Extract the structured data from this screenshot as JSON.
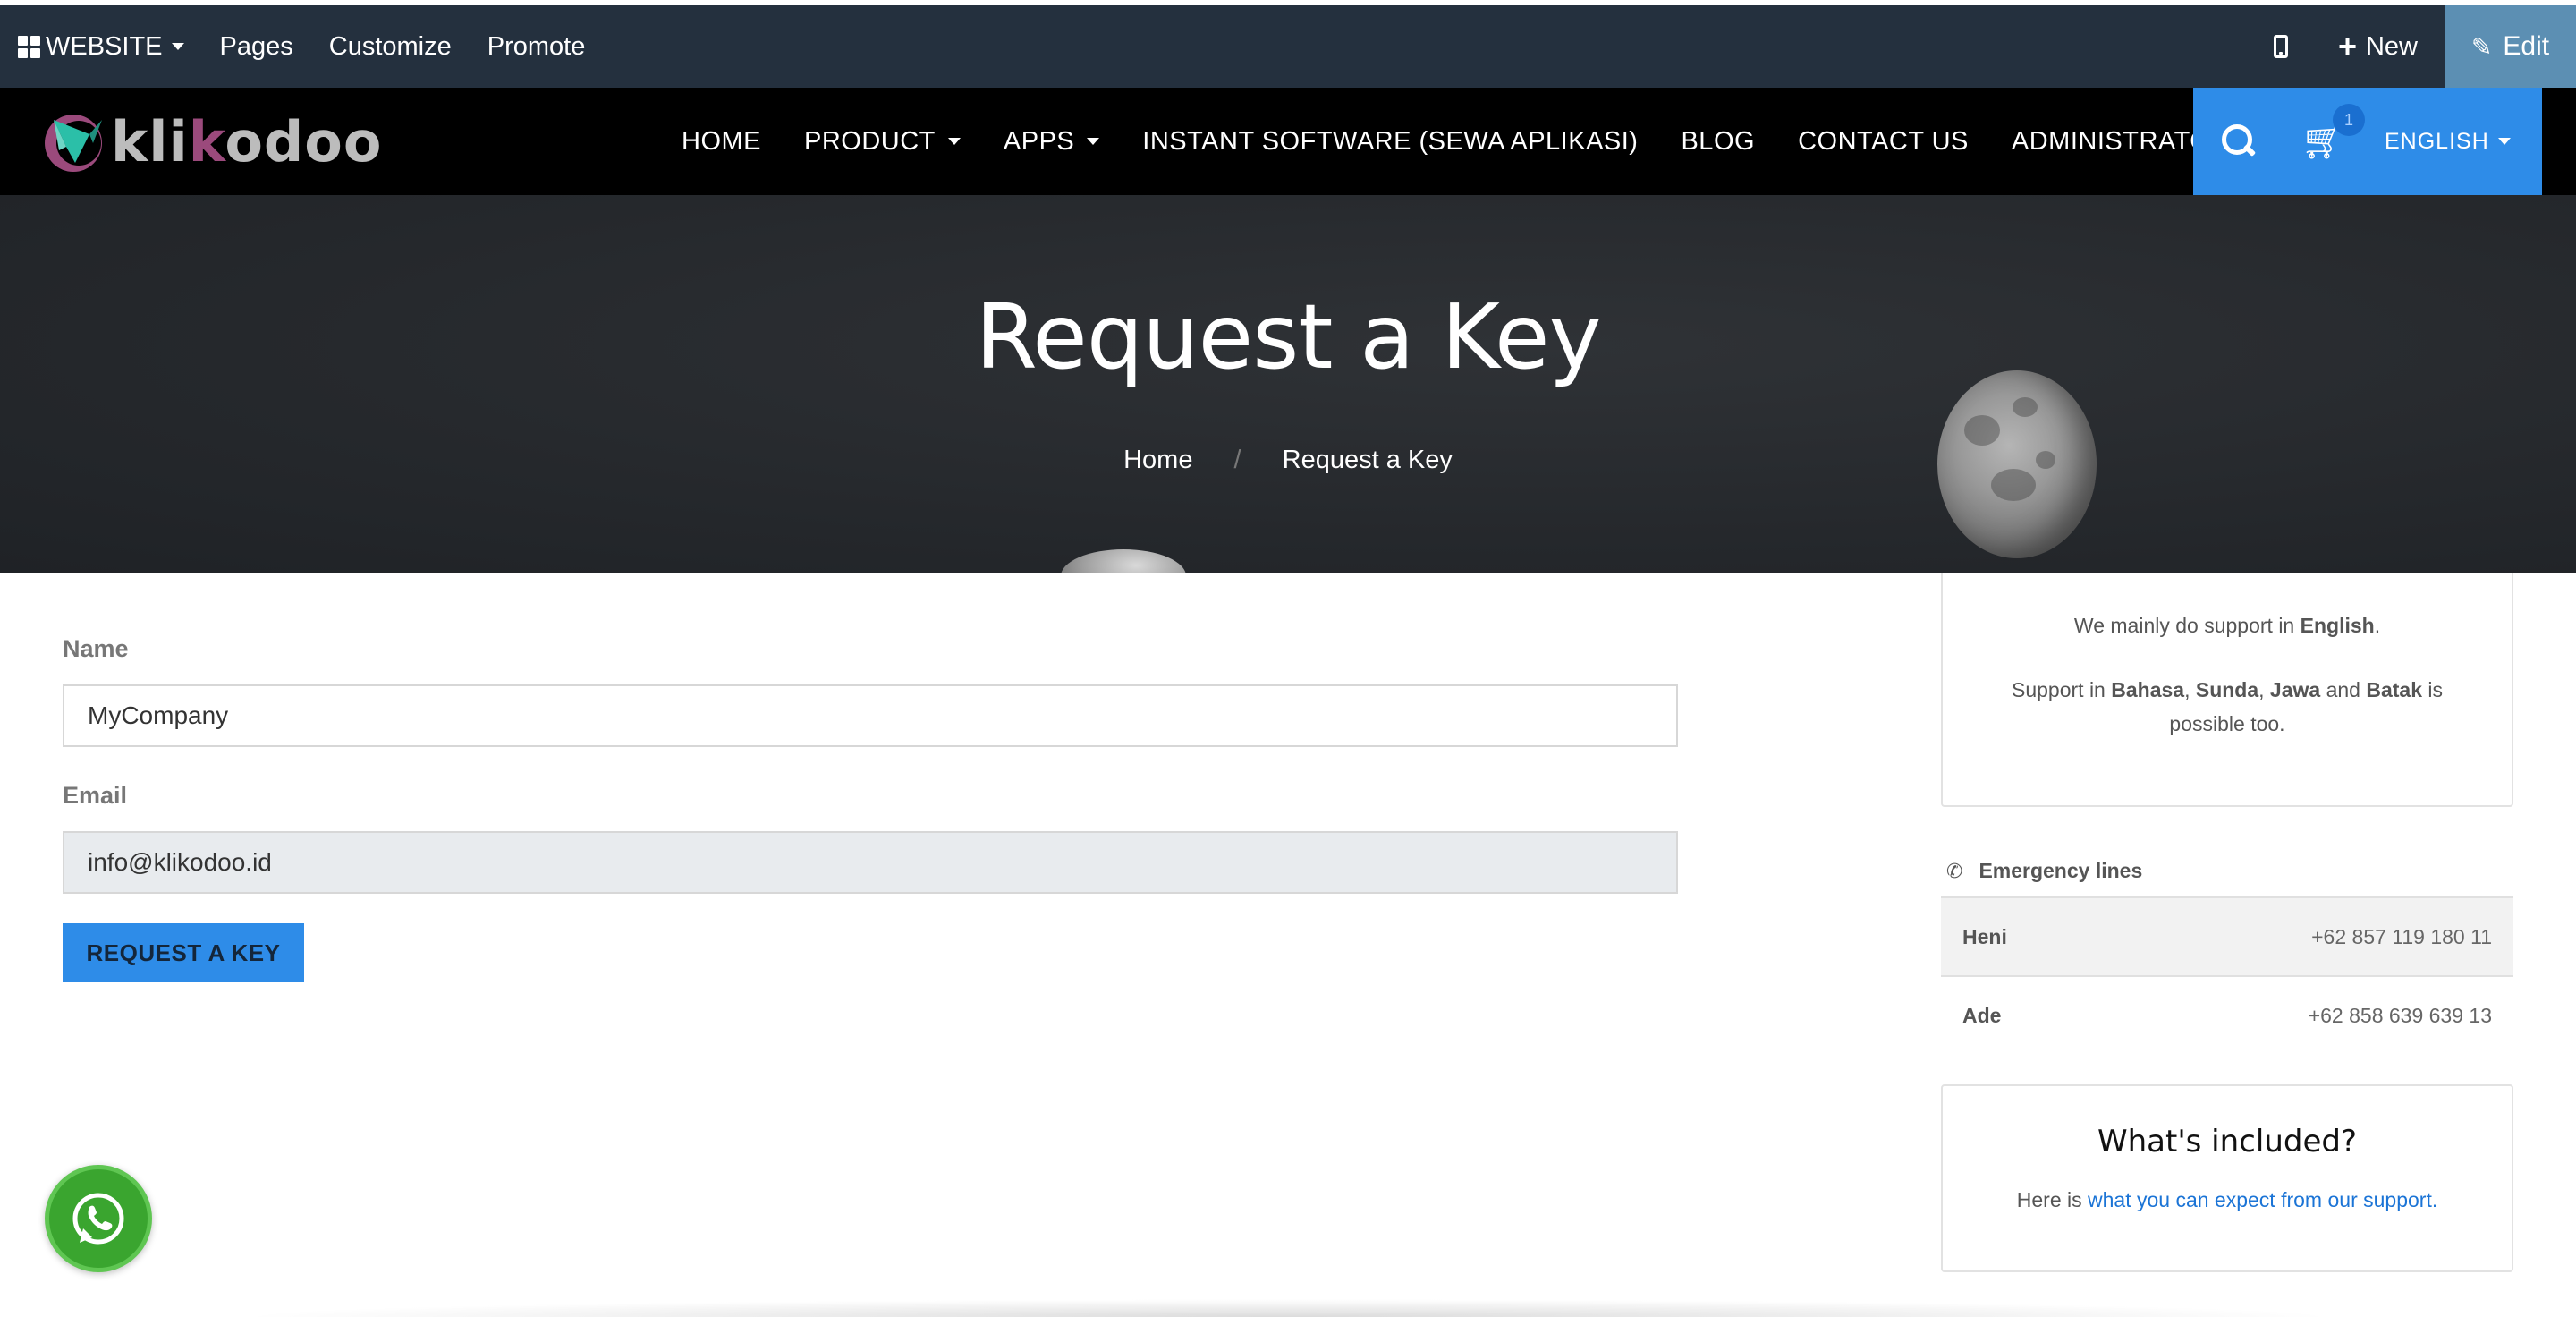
{
  "admin_bar": {
    "website_label": "WEBSITE",
    "pages_label": "Pages",
    "customize_label": "Customize",
    "promote_label": "Promote",
    "new_label": "New",
    "edit_label": "Edit"
  },
  "navbar": {
    "logo": {
      "part1": "kli",
      "part2": "k",
      "part3": "odoo"
    },
    "items": [
      {
        "label": "HOME",
        "dropdown": false
      },
      {
        "label": "PRODUCT",
        "dropdown": true
      },
      {
        "label": "APPS",
        "dropdown": true
      },
      {
        "label": "INSTANT SOFTWARE (SEWA APLIKASI)",
        "dropdown": false
      },
      {
        "label": "BLOG",
        "dropdown": false
      },
      {
        "label": "CONTACT US",
        "dropdown": false
      },
      {
        "label": "ADMINISTRATOR",
        "dropdown": true
      }
    ],
    "cart_count": "1",
    "language": "ENGLISH",
    "accent_color": "#2e8ce8"
  },
  "hero": {
    "title": "Request a Key",
    "breadcrumb": {
      "home": "Home",
      "separator": "/",
      "current": "Request a Key"
    }
  },
  "form": {
    "name_label": "Name",
    "name_value": "MyCompany",
    "email_label": "Email",
    "email_value": "info@klikodoo.id",
    "submit_label": "REQUEST A KEY"
  },
  "support_card": {
    "line1_prefix": "We mainly do support in ",
    "line1_lang": "English",
    "line1_suffix": ".",
    "line2_prefix": "Support in ",
    "lang1": "Bahasa",
    "comma1": ", ",
    "lang2": "Sunda",
    "comma2": ", ",
    "lang3": "Jawa",
    "and_text": " and ",
    "lang4": "Batak",
    "line2_suffix": " is possible too."
  },
  "emergency": {
    "title": "Emergency lines",
    "contacts": [
      {
        "name": "Heni",
        "phone": "+62 857 119 180 11"
      },
      {
        "name": "Ade",
        "phone": "+62 858 639 639 13"
      }
    ]
  },
  "included_card": {
    "title": "What's included?",
    "text_prefix": "Here is ",
    "link_text": "what you can expect from our support."
  }
}
